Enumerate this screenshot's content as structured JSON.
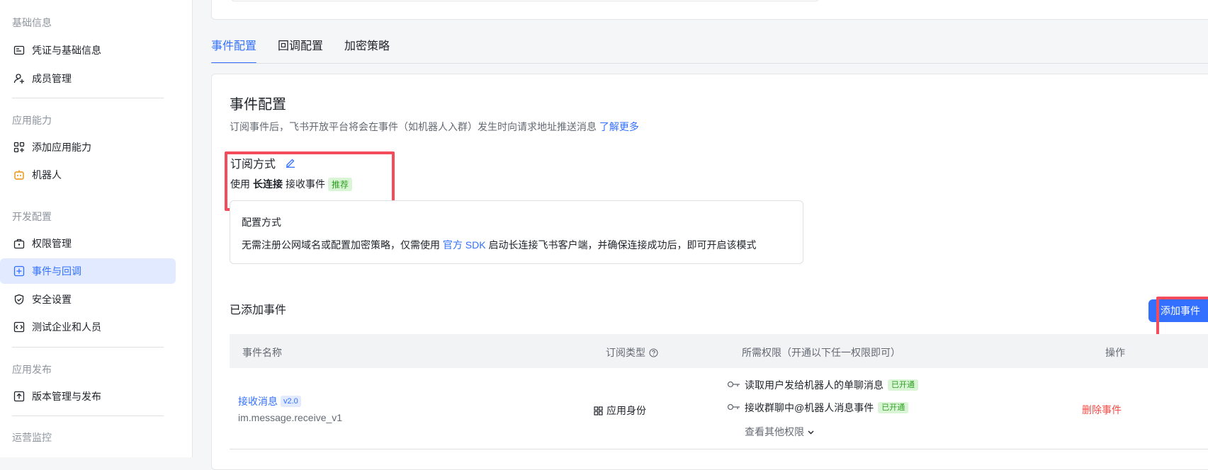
{
  "sidebar": {
    "groups": [
      "基础信息",
      "应用能力",
      "开发配置",
      "应用发布",
      "运营监控"
    ],
    "items": [
      {
        "label": "凭证与基础信息"
      },
      {
        "label": "成员管理"
      },
      {
        "label": "添加应用能力"
      },
      {
        "label": "机器人"
      },
      {
        "label": "权限管理"
      },
      {
        "label": "事件与回调"
      },
      {
        "label": "安全设置"
      },
      {
        "label": "测试企业和人员"
      },
      {
        "label": "版本管理与发布"
      }
    ]
  },
  "tabs": [
    "事件配置",
    "回调配置",
    "加密策略"
  ],
  "main": {
    "title": "事件配置",
    "desc": "订阅事件后，飞书开放平台将会在事件（如机器人入群）发生时向请求地址推送消息",
    "learn_more": "了解更多",
    "subscribe": {
      "title": "订阅方式",
      "prefix": "使用",
      "method": "长连接",
      "suffix": "接收事件",
      "badge": "推荐"
    },
    "config": {
      "title": "配置方式",
      "desc_pre": "无需注册公网域名或配置加密策略，仅需使用",
      "sdk_link": "官方 SDK",
      "desc_post": "启动长连接飞书客户端，并确保连接成功后，即可开启该模式"
    },
    "added_title": "已添加事件",
    "add_button": "添加事件",
    "table": {
      "headers": [
        "事件名称",
        "订阅类型",
        "所需权限（开通以下任一权限即可）",
        "操作"
      ],
      "rows": [
        {
          "name": "接收消息",
          "version": "v2.0",
          "key": "im.message.receive_v1",
          "type": "应用身份",
          "perms": [
            {
              "label": "读取用户发给机器人的单聊消息",
              "status": "已开通"
            },
            {
              "label": "接收群聊中@机器人消息事件",
              "status": "已开通"
            }
          ],
          "more": "查看其他权限",
          "action": "删除事件"
        }
      ]
    }
  },
  "colors": {
    "accent": "#3370ff",
    "highlight": "#f44c5a",
    "danger": "#f54a45",
    "success": "#2ea121"
  }
}
